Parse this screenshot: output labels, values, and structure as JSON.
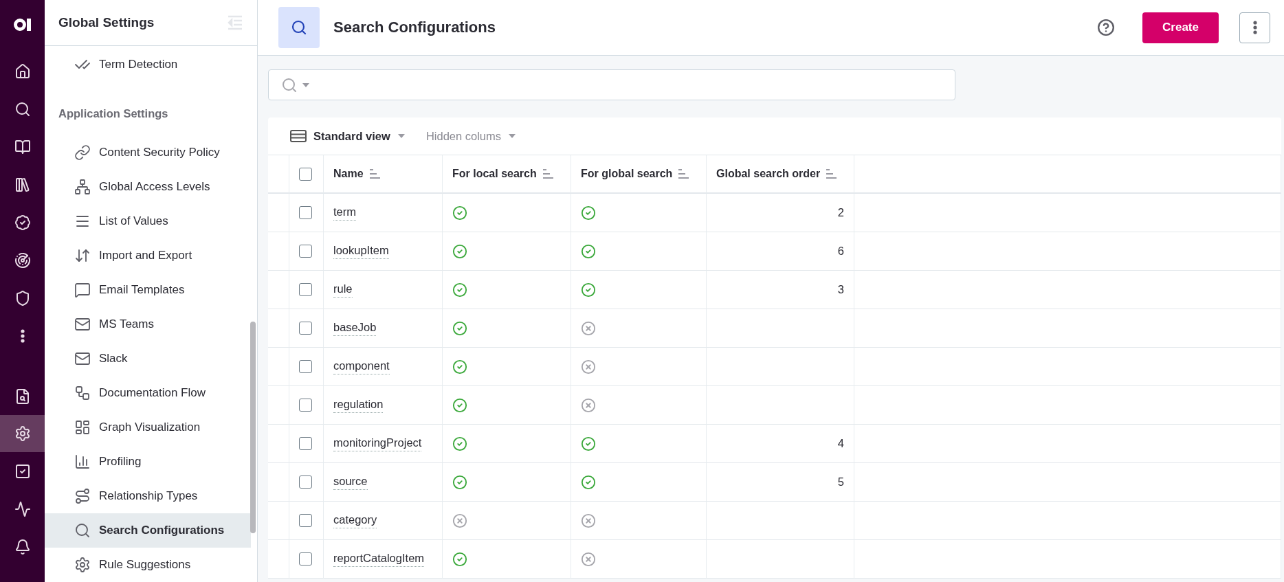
{
  "rail": [
    {
      "selected": false
    },
    {
      "selected": false
    },
    {
      "selected": false
    },
    {
      "selected": false
    },
    {
      "selected": false
    },
    {
      "selected": false
    },
    {
      "selected": false
    },
    {
      "selected": false
    },
    {
      "selected": false
    },
    {
      "selected": true
    },
    {
      "selected": false
    },
    {
      "selected": false
    },
    {
      "selected": false
    }
  ],
  "sidebar": {
    "title": "Global Settings",
    "items": [
      {
        "kind": "item",
        "label": "Term Detection",
        "selected": false
      },
      {
        "kind": "section",
        "label": "Application Settings"
      },
      {
        "kind": "item",
        "label": "Content Security Policy",
        "selected": false
      },
      {
        "kind": "item",
        "label": "Global Access Levels",
        "selected": false
      },
      {
        "kind": "item",
        "label": "List of Values",
        "selected": false
      },
      {
        "kind": "item",
        "label": "Import and Export",
        "selected": false
      },
      {
        "kind": "item",
        "label": "Email Templates",
        "selected": false
      },
      {
        "kind": "item",
        "label": "MS Teams",
        "selected": false
      },
      {
        "kind": "item",
        "label": "Slack",
        "selected": false
      },
      {
        "kind": "item",
        "label": "Documentation Flow",
        "selected": false
      },
      {
        "kind": "item",
        "label": "Graph Visualization",
        "selected": false
      },
      {
        "kind": "item",
        "label": "Profiling",
        "selected": false
      },
      {
        "kind": "item",
        "label": "Relationship Types",
        "selected": false
      },
      {
        "kind": "item",
        "label": "Search Configurations",
        "selected": true
      },
      {
        "kind": "item",
        "label": "Rule Suggestions",
        "selected": false
      }
    ]
  },
  "header": {
    "title": "Search Configurations",
    "create_button": "Create"
  },
  "toolbar": {
    "view": "Standard view",
    "hidden_columns": "Hidden colums"
  },
  "table": {
    "header_checked": false,
    "columns": [
      "Name",
      "For local search",
      "For global search",
      "Global search order"
    ],
    "rows": [
      {
        "name": "term",
        "local": true,
        "global": true,
        "order": "2",
        "checked": false
      },
      {
        "name": "lookupItem",
        "local": true,
        "global": true,
        "order": "6",
        "checked": false
      },
      {
        "name": "rule",
        "local": true,
        "global": true,
        "order": "3",
        "checked": false
      },
      {
        "name": "baseJob",
        "local": true,
        "global": false,
        "checked": false
      },
      {
        "name": "component",
        "local": true,
        "global": false,
        "checked": false
      },
      {
        "name": "regulation",
        "local": true,
        "global": false,
        "checked": false
      },
      {
        "name": "monitoringProject",
        "local": true,
        "global": true,
        "order": "4",
        "checked": false
      },
      {
        "name": "source",
        "local": true,
        "global": true,
        "order": "5",
        "checked": false
      },
      {
        "name": "category",
        "local": false,
        "global": false,
        "checked": false
      },
      {
        "name": "reportCatalogItem",
        "local": true,
        "global": false,
        "checked": false
      }
    ]
  }
}
